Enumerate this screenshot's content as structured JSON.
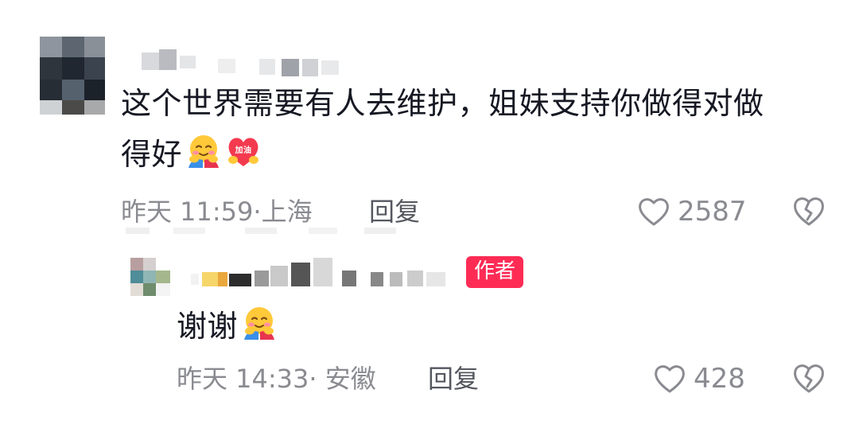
{
  "comment": {
    "text_line1": "这个世界需要有人去维护，姐妹支持你做得对做",
    "text_line2": "得好",
    "emoji": [
      "hugging-face",
      "jiayou-heart"
    ],
    "jiayou_label": "加油",
    "timestamp": "昨天 11:59",
    "location": "上海",
    "reply_label": "回复",
    "like_count": "2587"
  },
  "reply": {
    "author_badge": "作者",
    "text": "谢谢",
    "emoji": [
      "hugging-face"
    ],
    "timestamp": "昨天 14:33",
    "location": "安徽",
    "reply_label": "回复",
    "like_count": "428"
  },
  "colors": {
    "badge": "#fe2c55",
    "meta": "#8a8b91",
    "text": "#161823"
  }
}
